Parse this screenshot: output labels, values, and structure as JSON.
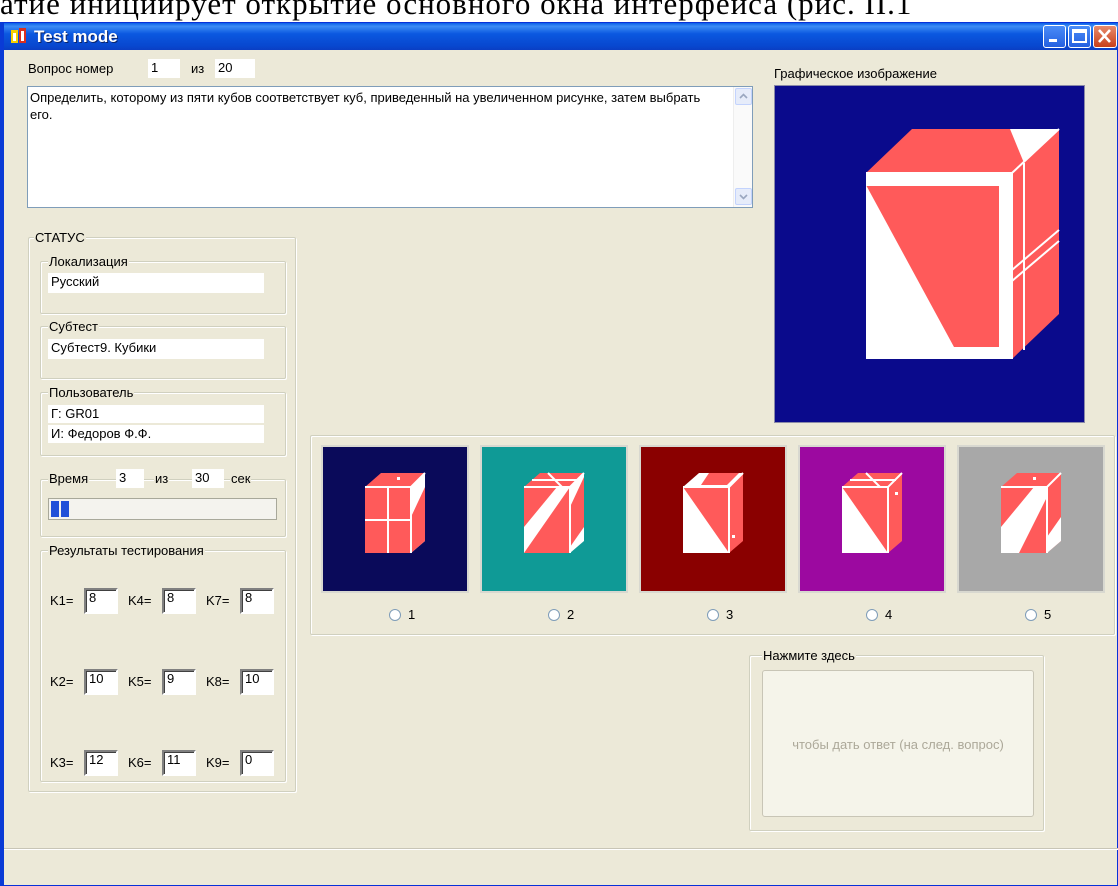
{
  "doc_caption": "атие инициирует открытие основного окна интерфейса (рис. II.1",
  "window": {
    "title": "Test mode",
    "controls": {
      "minimize": "minimize-icon",
      "maximize": "maximize-icon",
      "close": "close-icon"
    }
  },
  "question": {
    "label": "Вопрос  номер",
    "number": "1",
    "of_label": "из",
    "total": "20",
    "text": "Определить, которому из пяти кубов соответствует куб, приведенный на увеличенном рисунке, затем выбрать его."
  },
  "image_panel": {
    "label": "Графическое изображение"
  },
  "status": {
    "title": "СТАТУС",
    "localization": {
      "label": "Локализация",
      "value": "Русский"
    },
    "subtest": {
      "label": "Субтест",
      "value": "Субтест9. Кубики"
    },
    "user": {
      "label": "Пользователь",
      "group": "Г:  GR01",
      "name": "И:  Федоров Ф.Ф."
    },
    "time": {
      "label": "Время",
      "current": "3",
      "of_label": "из",
      "total": "30",
      "unit": "сек",
      "progress_fraction": 0.1
    }
  },
  "results": {
    "title": "Результаты тестирования",
    "rows": [
      [
        {
          "label": "K1=",
          "value": "8"
        },
        {
          "label": "K4=",
          "value": "8"
        },
        {
          "label": "K7=",
          "value": "8"
        }
      ],
      [
        {
          "label": "K2=",
          "value": "10"
        },
        {
          "label": "K5=",
          "value": "9"
        },
        {
          "label": "K8=",
          "value": "10"
        }
      ],
      [
        {
          "label": "K3=",
          "value": "12"
        },
        {
          "label": "K6=",
          "value": "11"
        },
        {
          "label": "K9=",
          "value": "0"
        }
      ]
    ]
  },
  "options": [
    {
      "label": "1",
      "bg": "#0a0a5a"
    },
    {
      "label": "2",
      "bg": "#0f9a96"
    },
    {
      "label": "3",
      "bg": "#8a0000"
    },
    {
      "label": "4",
      "bg": "#9c09a0"
    },
    {
      "label": "5",
      "bg": "#a8a8a8"
    }
  ],
  "submit": {
    "group_label": "Нажмите здесь",
    "button_label": "чтобы дать ответ (на след. вопрос)"
  },
  "colors": {
    "cube_face": "#ff5a5a",
    "main_image_bg": "#0a0a8c",
    "titlebar": "#0a4fdc"
  }
}
